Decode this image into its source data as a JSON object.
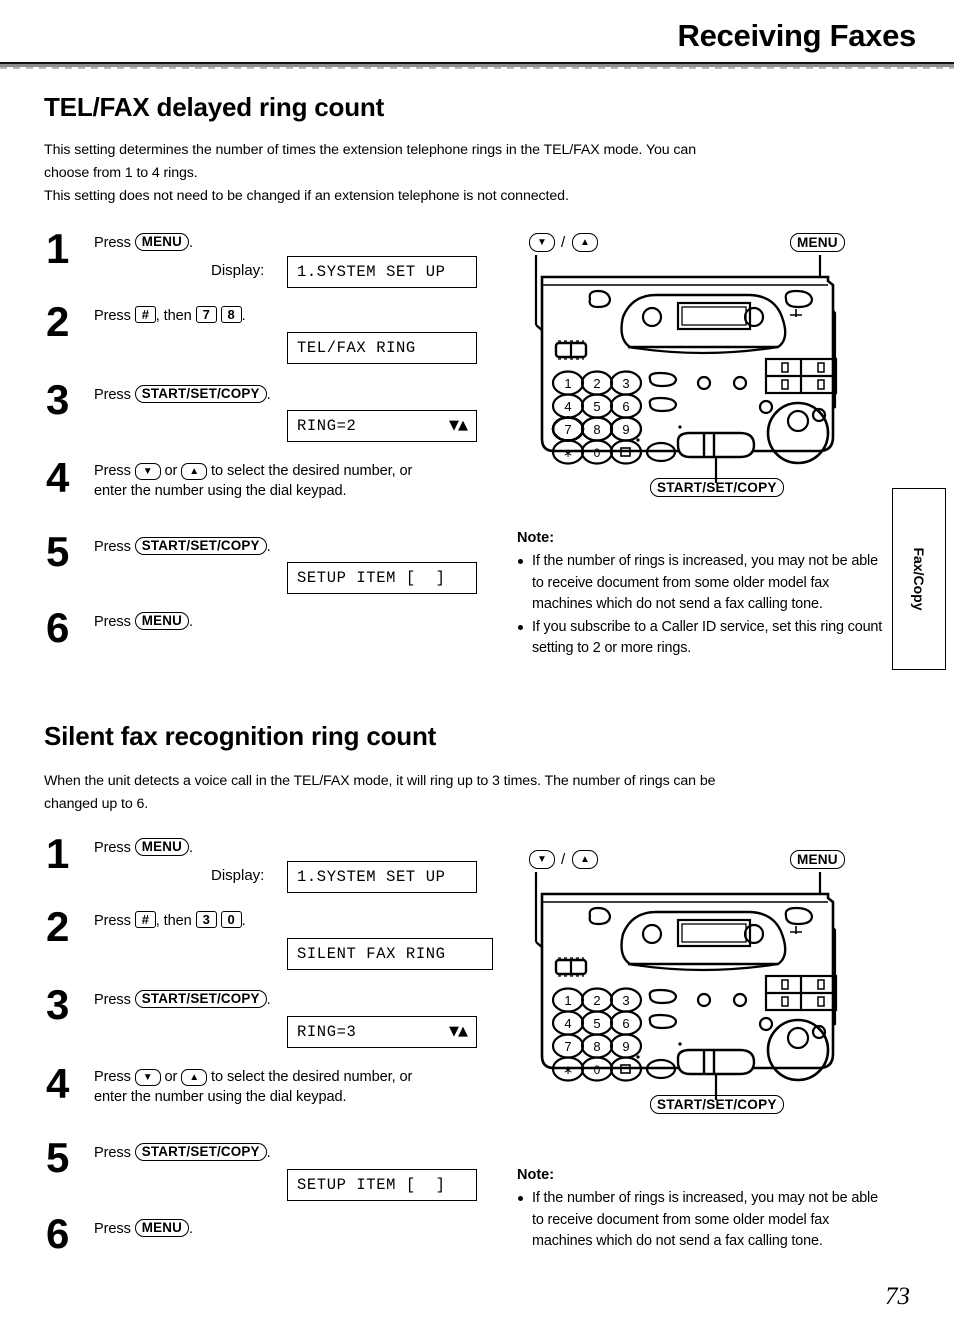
{
  "header": {
    "title": "Receiving Faxes"
  },
  "page_number": "73",
  "side_tab": {
    "label": "Fax/Copy"
  },
  "sections": [
    {
      "id": "tel-fax-delayed-ring-count",
      "heading": "TEL/FAX delayed ring count",
      "intro": "This setting determines the number of times the extension telephone rings in the TEL/FAX mode. You can choose from 1 to 4 rings.\nThis setting does not need to be changed if an extension telephone is not connected.",
      "intro_lines": [
        "This setting determines the number of times the extension telephone rings in the TEL/FAX mode. You can",
        "choose from 1 to 4 rings.",
        "This setting does not need to be changed if an extension telephone is not connected."
      ],
      "display_label": "Display:",
      "steps": [
        {
          "num": "1",
          "text_prefix": "Press ",
          "keys": [
            "MENU"
          ],
          "text_suffix": ".",
          "lcd": "1.SYSTEM SET UP",
          "lcd_arrows": ""
        },
        {
          "num": "2",
          "text_prefix": "Press ",
          "keys": [
            "#"
          ],
          "text_mid": ", then ",
          "keys2": [
            "7",
            "8"
          ],
          "text_suffix": ".",
          "lcd": "TEL/FAX RING",
          "lcd_arrows": ""
        },
        {
          "num": "3",
          "text_prefix": "Press ",
          "keys": [
            "START/SET/COPY"
          ],
          "text_suffix": ".",
          "lcd": "RING=2",
          "lcd_arrows": "▼▲"
        },
        {
          "num": "4",
          "text_line1": "Press ▼ or ▲ to select the desired number, or",
          "text_line2": "enter the number using the dial keypad.",
          "lcd": "",
          "lcd_arrows": ""
        },
        {
          "num": "5",
          "text_prefix": "Press ",
          "keys": [
            "START/SET/COPY"
          ],
          "text_suffix": ".",
          "lcd": "SETUP ITEM [  ]",
          "lcd_arrows": ""
        },
        {
          "num": "6",
          "text_prefix": "Press ",
          "keys": [
            "MENU"
          ],
          "text_suffix": ".",
          "lcd": "",
          "lcd_arrows": ""
        }
      ],
      "note": {
        "title": "Note:",
        "items": [
          "If the number of rings is increased, you may not be able to receive document from some older model fax machines which do not send a fax calling tone.",
          "If you subscribe to a Caller ID service, set this ring count setting to 2 or more rings."
        ]
      },
      "diagram": {
        "callout_arrows": "▼",
        "callout_arrows_up": "▲",
        "callout_separator": "/",
        "callout_menu": "MENU",
        "callout_start": "START/SET/COPY",
        "keypad": [
          [
            "1",
            "2",
            "3"
          ],
          [
            "4",
            "5",
            "6"
          ],
          [
            "7",
            "8",
            "9"
          ],
          [
            "∗",
            "0",
            "□"
          ]
        ]
      }
    },
    {
      "id": "silent-fax-recognition-ring-count",
      "heading": "Silent fax recognition ring count",
      "intro_lines": [
        "When the unit detects a voice call in the TEL/FAX mode, it will ring up to 3 times. The number of rings can be",
        "changed up to 6."
      ],
      "display_label": "Display:",
      "steps": [
        {
          "num": "1",
          "text_prefix": "Press ",
          "keys": [
            "MENU"
          ],
          "text_suffix": ".",
          "lcd": "1.SYSTEM SET UP",
          "lcd_arrows": ""
        },
        {
          "num": "2",
          "text_prefix": "Press ",
          "keys": [
            "#"
          ],
          "text_mid": ", then ",
          "keys2": [
            "3",
            "0"
          ],
          "text_suffix": ".",
          "lcd": "SILENT FAX RING",
          "lcd_arrows": ""
        },
        {
          "num": "3",
          "text_prefix": "Press ",
          "keys": [
            "START/SET/COPY"
          ],
          "text_suffix": ".",
          "lcd": "RING=3",
          "lcd_arrows": "▼▲"
        },
        {
          "num": "4",
          "text_line1": "Press ▼ or ▲ to select the desired number, or",
          "text_line2": "enter the number using the dial keypad.",
          "lcd": "",
          "lcd_arrows": ""
        },
        {
          "num": "5",
          "text_prefix": "Press ",
          "keys": [
            "START/SET/COPY"
          ],
          "text_suffix": ".",
          "lcd": "SETUP ITEM [  ]",
          "lcd_arrows": ""
        },
        {
          "num": "6",
          "text_prefix": "Press ",
          "keys": [
            "MENU"
          ],
          "text_suffix": ".",
          "lcd": "",
          "lcd_arrows": ""
        }
      ],
      "note": {
        "title": "Note:",
        "items": [
          "If the number of rings is increased, you may not be able to receive document from some older model fax machines which do not send a fax calling tone."
        ]
      },
      "diagram": {
        "callout_arrows": "▼",
        "callout_arrows_up": "▲",
        "callout_separator": "/",
        "callout_menu": "MENU",
        "callout_start": "START/SET/COPY",
        "keypad": [
          [
            "1",
            "2",
            "3"
          ],
          [
            "4",
            "5",
            "6"
          ],
          [
            "7",
            "8",
            "9"
          ],
          [
            "∗",
            "0",
            "□"
          ]
        ]
      }
    }
  ],
  "step4_text": {
    "press": "Press ",
    "or": " or ",
    "rest": " to select the desired number, or",
    "line2": "enter the number using the dial keypad."
  },
  "colors": {
    "ink": "#000000",
    "rule": "#8c8c8c"
  }
}
